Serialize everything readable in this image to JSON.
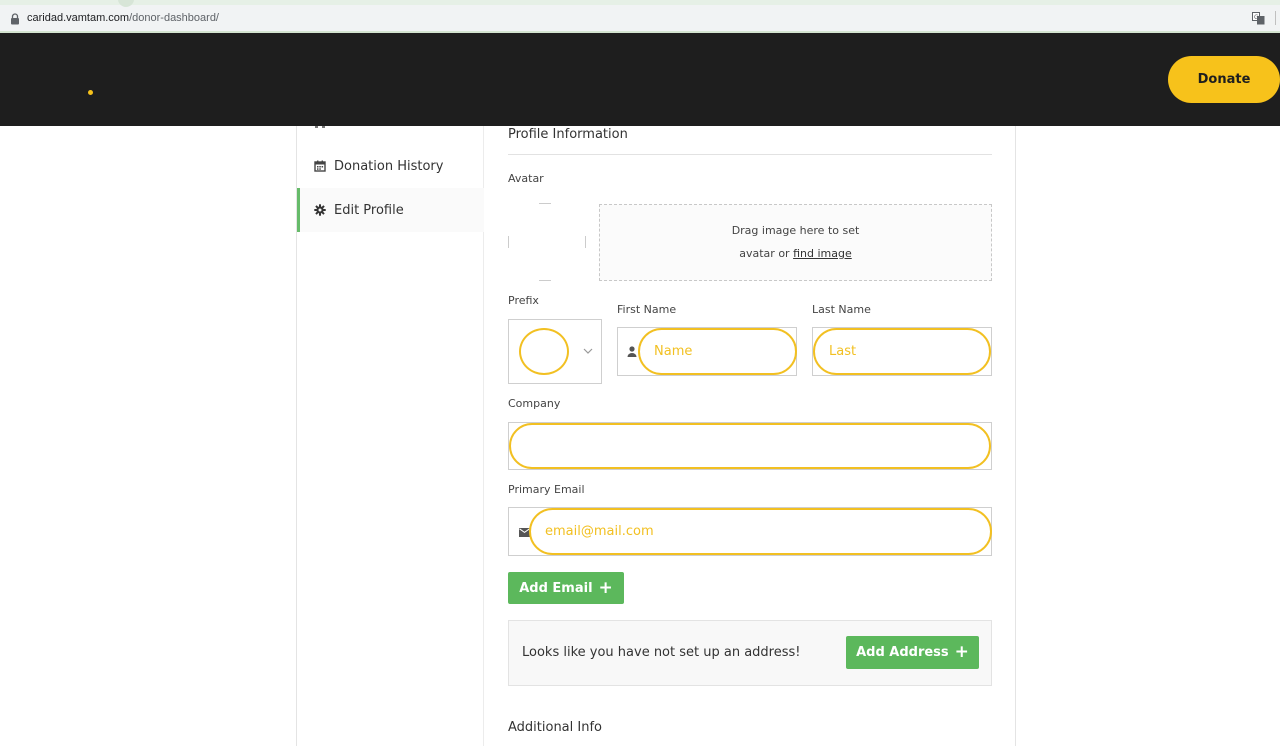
{
  "browser": {
    "url_host": "caridad.vamtam.com",
    "url_path": "/donor-dashboard/"
  },
  "header": {
    "donate_label": "Donate",
    "brand_color": "#f7c21b"
  },
  "sidebar": {
    "items": [
      {
        "label": "Donation History",
        "icon": "calendar-icon"
      },
      {
        "label": "Edit Profile",
        "icon": "gear-icon",
        "active": true
      }
    ],
    "active_color": "#66bb6a"
  },
  "profile": {
    "section_title": "Profile Information",
    "avatar_label": "Avatar",
    "dropzone_line1": "Drag image here to set",
    "dropzone_line2_prefix": "avatar or",
    "dropzone_link": "find image",
    "prefix_label": "Prefix",
    "first_name_label": "First Name",
    "first_name_placeholder": "Name",
    "last_name_label": "Last Name",
    "last_name_placeholder": "Last",
    "company_label": "Company",
    "company_placeholder": "",
    "email_label": "Primary Email",
    "email_placeholder": "email@mail.com",
    "add_email_label": "Add Email",
    "address_message": "Looks like you have not set up an address!",
    "add_address_label": "Add Address",
    "additional_title": "Additional Info"
  },
  "colors": {
    "accent": "#f2c022",
    "button": "#5cb85c",
    "header_bg": "#1e1e1e"
  }
}
